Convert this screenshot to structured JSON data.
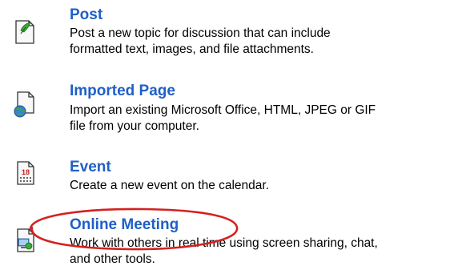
{
  "items": [
    {
      "title": "Post",
      "desc_line1": "Post a new topic for discussion that can include",
      "desc_line2": "formatted text, images, and file attachments.",
      "icon": "document-post-icon"
    },
    {
      "title": "Imported Page",
      "desc_line1": "Import an existing Microsoft Office, HTML, JPEG or GIF",
      "desc_line2": "file from your computer.",
      "icon": "document-import-icon"
    },
    {
      "title": "Event",
      "desc_line1": "Create a new event on the calendar.",
      "icon": "calendar-icon",
      "icon_text": "18"
    },
    {
      "title": "Online Meeting",
      "desc_line1": "Work with others in real time using screen sharing, chat,",
      "desc_line2": "and other tools.",
      "icon": "online-meeting-icon"
    }
  ],
  "colors": {
    "title": "#1f5fc8",
    "highlight": "#d42020"
  }
}
